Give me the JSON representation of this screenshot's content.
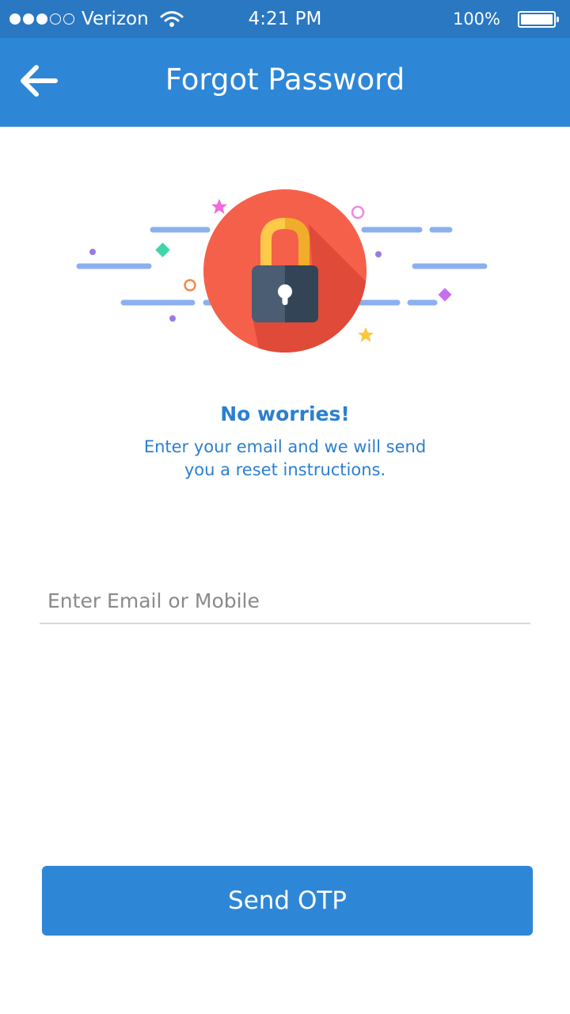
{
  "status_bar": {
    "carrier": "Verizon",
    "time": "4:21 PM",
    "battery": "100%"
  },
  "app_bar": {
    "title": "Forgot Password",
    "back_icon": "back-arrow-icon"
  },
  "hero": {
    "icon": "lock-icon",
    "colors": {
      "circle": "#f5604a",
      "shackle": "#ffc94a",
      "body": "#3d4f62",
      "streaks": "#8bb0f0"
    }
  },
  "message": {
    "headline": "No worries!",
    "line1": "Enter your email and we will send",
    "line2": "you a reset instructions."
  },
  "form": {
    "placeholder": "Enter Email or Mobile",
    "value": ""
  },
  "actions": {
    "send_label": "Send OTP"
  },
  "theme": {
    "primary": "#2e86d6",
    "status_bar": "#2a77c2",
    "text_accent": "#2b7fd0"
  }
}
